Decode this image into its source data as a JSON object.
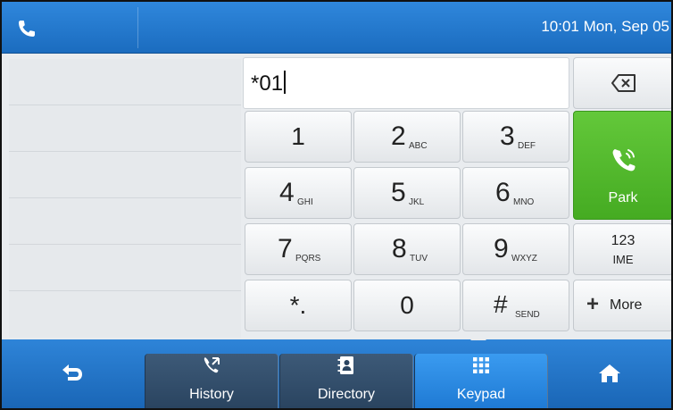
{
  "status_bar": {
    "clock": "10:01 Mon, Sep 05",
    "icon": "handset-icon"
  },
  "dial_input": {
    "value": "*01"
  },
  "keys": [
    {
      "digit": "1",
      "letters": ""
    },
    {
      "digit": "2",
      "letters": "ABC"
    },
    {
      "digit": "3",
      "letters": "DEF"
    },
    {
      "digit": "4",
      "letters": "GHI"
    },
    {
      "digit": "5",
      "letters": "JKL"
    },
    {
      "digit": "6",
      "letters": "MNO"
    },
    {
      "digit": "7",
      "letters": "PQRS"
    },
    {
      "digit": "8",
      "letters": "TUV"
    },
    {
      "digit": "9",
      "letters": "WXYZ"
    },
    {
      "digit": "*.",
      "letters": ""
    },
    {
      "digit": "0",
      "letters": ""
    },
    {
      "digit": "#",
      "letters": "SEND"
    }
  ],
  "side_keys": {
    "park_label": "Park",
    "ime_top": "123",
    "ime_bottom": "IME",
    "more_label": "More"
  },
  "bottom_nav": {
    "tabs": [
      {
        "label": "History",
        "icon": "history-icon"
      },
      {
        "label": "Directory",
        "icon": "directory-icon"
      },
      {
        "label": "Keypad",
        "icon": "keypad-icon",
        "active": true
      }
    ],
    "back_icon": "back-icon",
    "home_icon": "home-icon"
  },
  "colors": {
    "accent_blue": "#1f7ad4",
    "park_green": "#52b82c"
  }
}
